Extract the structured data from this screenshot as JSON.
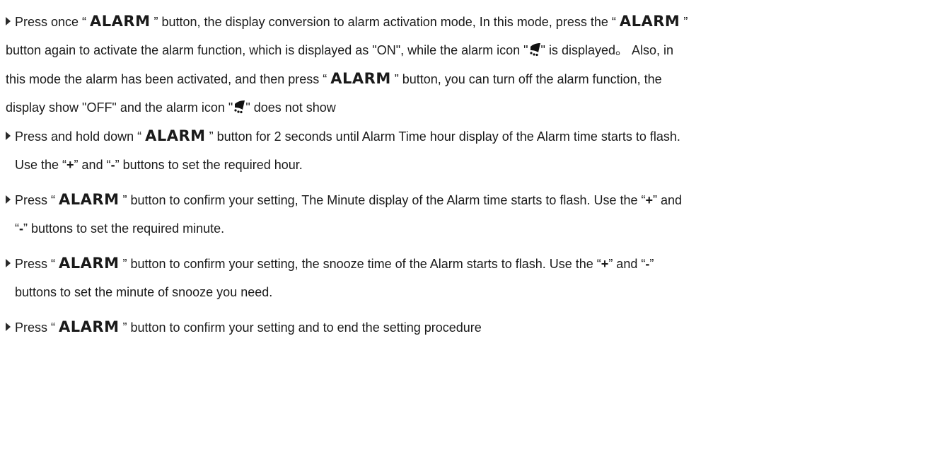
{
  "bullet_glyph": "arrow-right-icon",
  "button_name": "ALARM",
  "bullets": [
    {
      "lines": [
        {
          "a": "Press once “ ",
          "b": " ” button, the display conversion to alarm activation mode, In this mode, press the “ ",
          "c": " ”"
        },
        {
          "a": "button again to activate the alarm function, which is displayed as \"ON\", while the alarm icon \"",
          "b": "\" is displayed。 Also, in"
        },
        {
          "a": "this mode the alarm has been activated, and then press “ ",
          "b": " ” button, you can turn off the alarm function, the"
        },
        {
          "a": "display show \"OFF\" and the alarm icon \"",
          "b": "\" does not show"
        }
      ]
    },
    {
      "line1": {
        "a": "Press and hold down “ ",
        "b": " ” button for 2 seconds until Alarm Time hour display of the Alarm time starts to flash."
      },
      "line2": {
        "a": "Use the “",
        "plus": "+",
        "b": "” and “",
        "minus": "-",
        "c": "” buttons to set the required hour."
      }
    },
    {
      "line1": {
        "a": "Press “ ",
        "b": " ” button to confirm your setting, The Minute display of the Alarm time starts to flash. Use the “",
        "plus": "+",
        "c": "” and"
      },
      "line2": {
        "a": "“",
        "minus": "-",
        "b": "” buttons to set the required minute."
      }
    },
    {
      "line1": {
        "a": "Press “ ",
        "b": " ” button to confirm your setting, the snooze time of the Alarm starts to flash. Use the “",
        "plus": "+",
        "c": "” and “",
        "minus": "-",
        "d": "”"
      },
      "line2": {
        "a": "buttons to set the minute of snooze you need."
      }
    },
    {
      "line1": {
        "a": "Press “ ",
        "b": " ” button to confirm your setting and to end the setting procedure"
      }
    }
  ]
}
